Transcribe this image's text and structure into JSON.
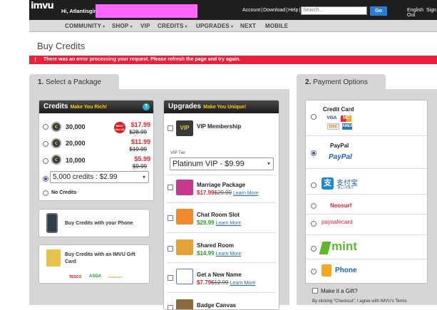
{
  "header": {
    "logo_text": "imvu",
    "greeting": "Hi, Atlantisgirl!",
    "links": [
      "Account",
      "Download",
      "Help"
    ],
    "search_placeholder": "Search...",
    "go_label": "Go",
    "lang_links": [
      "English",
      "Sign Out"
    ]
  },
  "nav": {
    "items": [
      {
        "label": "COMMUNITY",
        "caret": true
      },
      {
        "label": "SHOP",
        "caret": true
      },
      {
        "label": "VIP",
        "caret": false
      },
      {
        "label": "CREDITS",
        "caret": true
      },
      {
        "label": "UPGRADES",
        "caret": true
      },
      {
        "label": "NEXT",
        "caret": false
      },
      {
        "label": "MOBILE",
        "caret": false
      }
    ]
  },
  "page": {
    "title": "Buy Credits",
    "error_icon": "!",
    "error": "There was an error processing your request. Please refresh the page and try again."
  },
  "step1": {
    "number": "1.",
    "label": "Select a Package"
  },
  "credits": {
    "title": "Credits",
    "subtitle": "Make You Rich!",
    "help": "?",
    "best_value": "BEST VALUE",
    "packages": [
      {
        "amount": "30,000",
        "price": "$17.99",
        "old": "$28.99"
      },
      {
        "amount": "20,000",
        "price": "$11.99",
        "old": "$19.99"
      },
      {
        "amount": "10,000",
        "price": "$5.99",
        "old": "$9.99"
      }
    ],
    "custom_select": "5,000 credits : $2.99",
    "no_credits": "No Credits"
  },
  "buy_with_phone": "Buy Credits with your Phone",
  "buy_with_card": "Buy Credits with an IMVU Gift Card",
  "retailers": [
    "TESCO",
    "ASDA",
    "Sainsbury's"
  ],
  "upgrades": {
    "title": "Upgrades",
    "subtitle": "Make You Unique!",
    "vip_label": "VIP Membership",
    "vip_tier_label": "VIP Tier",
    "vip_tier_value": "Platinum VIP - $9.99",
    "learn_more": "Learn More",
    "items": [
      {
        "title": "Marriage Package",
        "price": "$17.99",
        "old": "$29.99",
        "color": "red"
      },
      {
        "title": "Chat Room Slot",
        "price": "$29.99",
        "old": "",
        "color": "green"
      },
      {
        "title": "Shared Room",
        "price": "$14.99",
        "old": "",
        "color": "green"
      },
      {
        "title": "Get a New Name",
        "price": "$7.79",
        "old": "$12.99",
        "color": "red"
      },
      {
        "title": "Badge Canvas",
        "price": "",
        "old": "",
        "color": "red"
      }
    ]
  },
  "step2": {
    "number": "2.",
    "label": "Payment Options"
  },
  "payment": {
    "options": [
      "Credit Card",
      "PayPal",
      "Alipay",
      "Neosurf",
      "paysafecard",
      "mint",
      "Phone"
    ],
    "selected": "PayPal",
    "paypal_logo": "PayPal",
    "alipay_cn": "支付宝",
    "alipay_en": "ALIPAY",
    "neosurf": "Neosurf",
    "paysafe": "paysafecard",
    "mint": "mint",
    "phone": "Phone",
    "card_logos": [
      "VISA",
      "MC",
      "DISC",
      "AMEX"
    ],
    "gift_label": "Make it a Gift?",
    "terms_text": "By clicking \"Checkout\", I agree with IMVU's Terms"
  },
  "colors": {
    "accent_red": "#e8203a",
    "link_blue": "#1a6fbd",
    "price_green": "#2a9a2a"
  }
}
